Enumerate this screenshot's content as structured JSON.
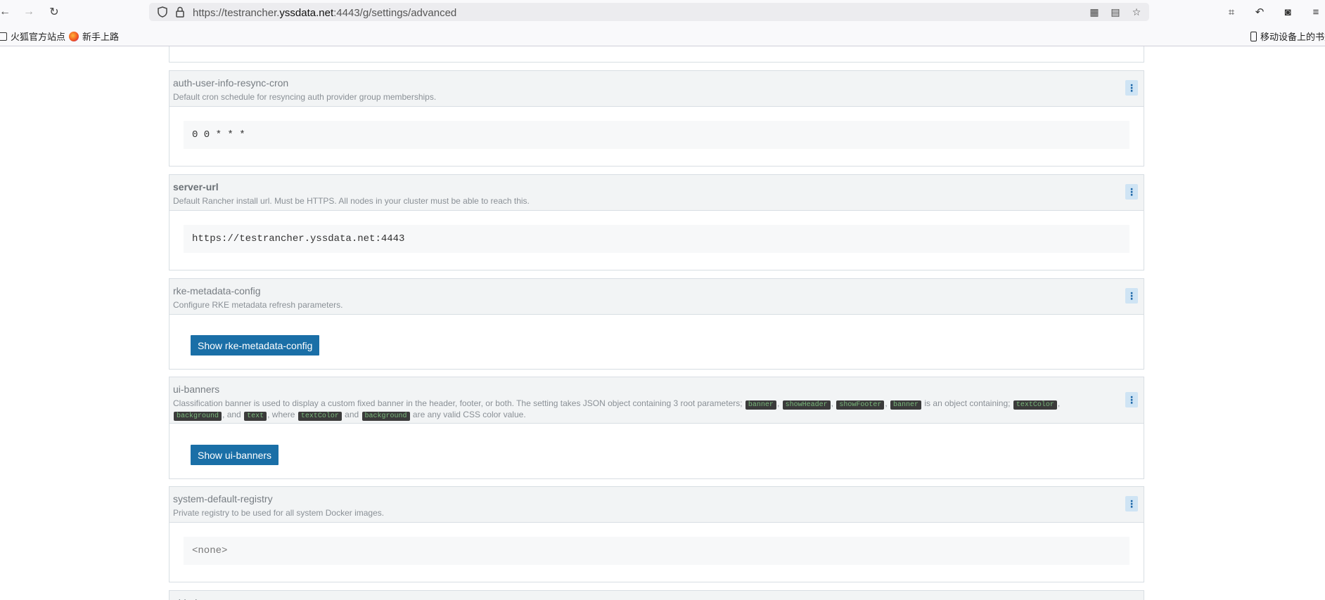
{
  "browser": {
    "url_prefix": "https://testrancher.",
    "url_domain": "yssdata.net",
    "url_suffix": ":4443/g/settings/advanced",
    "bookmarks": [
      "火狐官方站点",
      "新手上路"
    ],
    "mobile_bookmarks": "移动设备上的书签"
  },
  "settings": {
    "auth_resync": {
      "title": "auth-user-info-resync-cron",
      "desc": "Default cron schedule for resyncing auth provider group memberships.",
      "value": "0 0 * * *"
    },
    "server_url": {
      "title": "server-url",
      "desc": "Default Rancher install url. Must be HTTPS. All nodes in your cluster must be able to reach this.",
      "value": "https://testrancher.yssdata.net:4443"
    },
    "rke_metadata": {
      "title": "rke-metadata-config",
      "desc": "Configure RKE metadata refresh parameters.",
      "button": "Show rke-metadata-config"
    },
    "ui_banners": {
      "title": "ui-banners",
      "desc_1": "Classification banner is used to display a custom fixed banner in the header, footer, or both. The setting takes JSON object containing 3 root parameters;",
      "code_banner": "banner",
      "code_showHeader": "showHeader",
      "code_showFooter": "showFooter",
      "desc_2": "is an object containing;",
      "code_textColor": "textColor",
      "code_background": "background",
      "desc_and": "and",
      "code_text": "text",
      "desc_where": "where",
      "desc_end": "are any valid CSS color value.",
      "comma": ",",
      "button": "Show ui-banners"
    },
    "default_registry": {
      "title": "system-default-registry",
      "desc": "Private registry to be used for all system Docker images.",
      "value": "<none>"
    },
    "partial_next_title": "ui-index"
  },
  "icons": {
    "kebab": "⋮"
  }
}
